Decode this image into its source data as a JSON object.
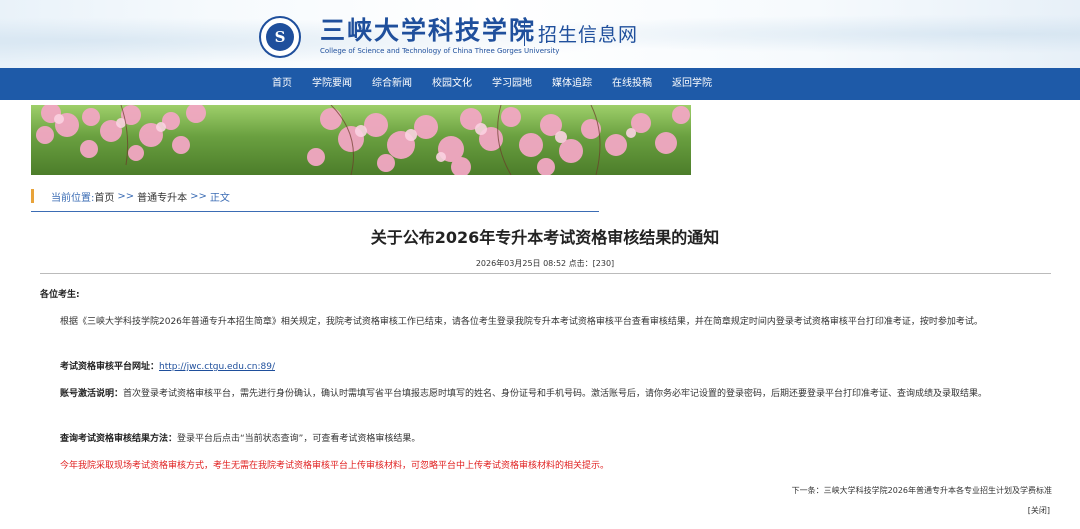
{
  "header": {
    "logo_emblem_text": "S",
    "school_name_cn": "三峡大学科技学院",
    "school_name_en": "College of Science and Technology of China Three Gorges University",
    "site_name": "招生信息网"
  },
  "nav": {
    "items": [
      "首页",
      "学院要闻",
      "综合新闻",
      "校园文化",
      "学习园地",
      "媒体追踪",
      "在线投稿",
      "返回学院"
    ]
  },
  "breadcrumb": {
    "label": "当前位置:",
    "home": "首页",
    "sep": ">>",
    "section": "普通专升本",
    "current": "正文"
  },
  "article": {
    "title": "关于公布2026年专升本考试资格审核结果的通知",
    "meta": "2026年03月25日 08:52 点击：[230]",
    "greeting": "各位考生:",
    "para1": "根据《三峡大学科技学院2026年普通专升本招生简章》相关规定，我院考试资格审核工作已结束，请各位考生登录我院专升本考试资格审核平台查看审核结果，并在简章规定时间内登录考试资格审核平台打印准考证，按时参加考试。",
    "platform_label": "考试资格审核平台网址：",
    "platform_url": "http://jwc.ctgu.edu.cn:89/",
    "activation_label": "账号激活说明：",
    "activation_text": "首次登录考试资格审核平台，需先进行身份确认，确认时需填写省平台填报志愿时填写的姓名、身份证号和手机号码。激活账号后，请你务必牢记设置的登录密码，后期还要登录平台打印准考证、查询成绩及录取结果。",
    "query_label": "查询考试资格审核结果方法：",
    "query_text": "登录平台后点击“当前状态查询”，可查看考试资格审核结果。",
    "notice_red": "今年我院采取现场考试资格审核方式，考生无需在我院考试资格审核平台上传审核材料，可忽略平台中上传考试资格审核材料的相关提示。"
  },
  "footer": {
    "next_label": "下一条：",
    "next_title": "三峡大学科技学院2026年普通专升本各专业招生计划及学费标准",
    "close_label": "[关闭]"
  },
  "colors": {
    "nav_bg": "#1e5aa8",
    "brand": "#1f4f9c",
    "accent_bar": "#e8a33a",
    "notice": "#e02020"
  }
}
